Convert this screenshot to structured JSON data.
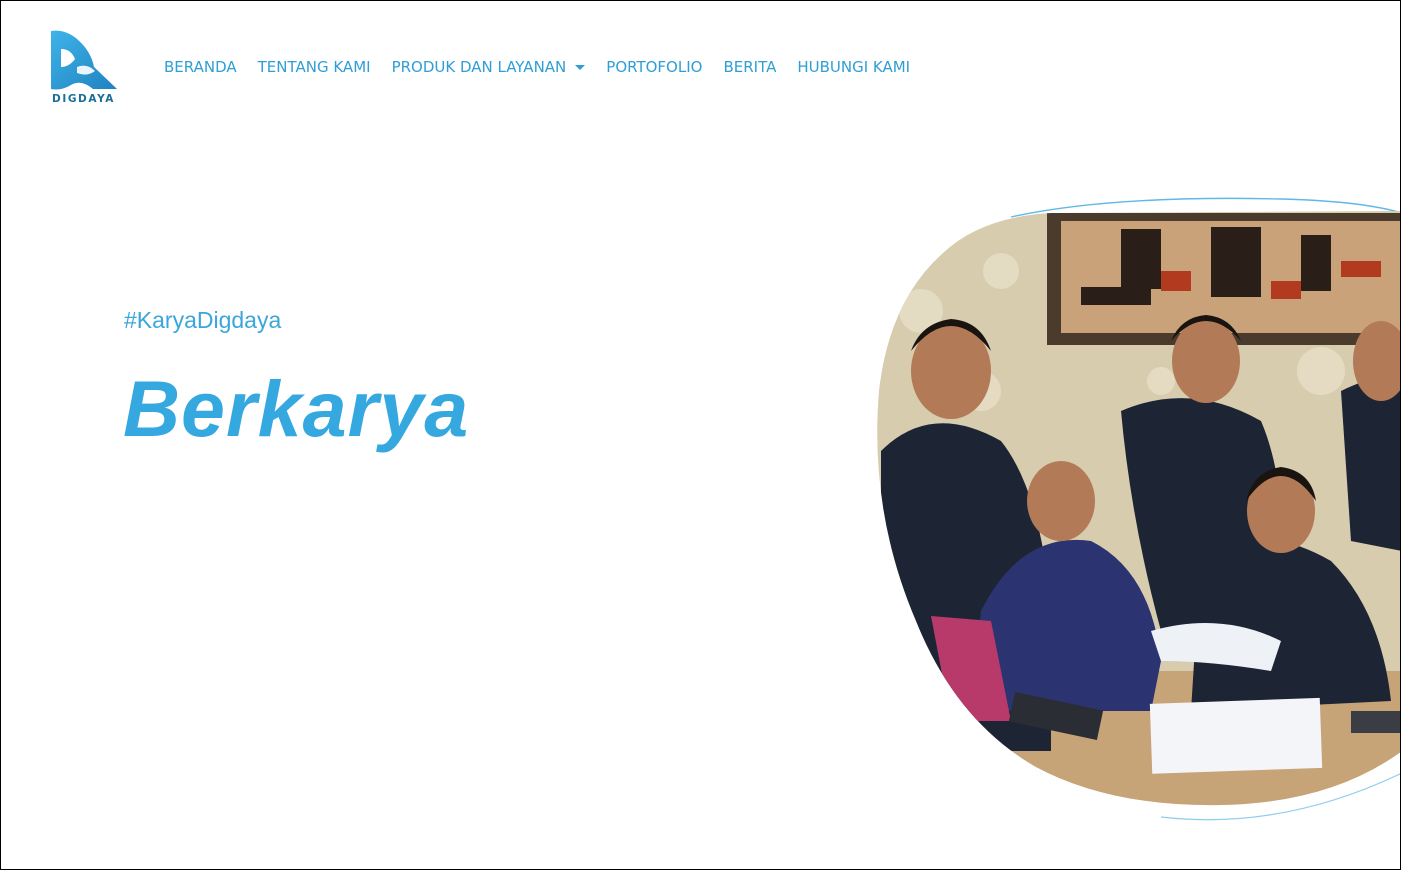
{
  "brand": {
    "name": "DIGDAYA",
    "primary_color": "#2f9ed6",
    "logo_color": "#2a94cf"
  },
  "nav": {
    "items": [
      {
        "label": "BERANDA"
      },
      {
        "label": "TENTANG KAMI"
      },
      {
        "label": "PRODUK DAN LAYANAN",
        "has_dropdown": true
      },
      {
        "label": "PORTOFOLIO"
      },
      {
        "label": "BERITA"
      },
      {
        "label": "HUBUNGI KAMI"
      }
    ]
  },
  "hero": {
    "hashtag": "#KaryaDigdaya",
    "headline": "Berkarya",
    "image": "team-photo"
  }
}
